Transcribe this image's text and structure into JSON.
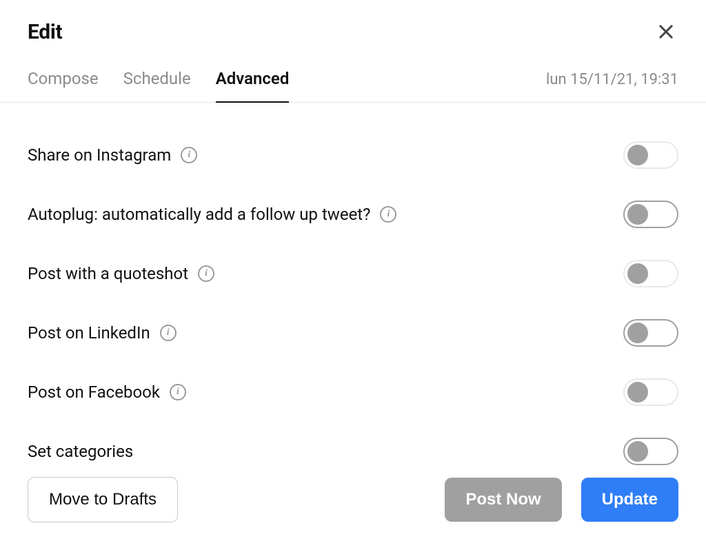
{
  "header": {
    "title": "Edit",
    "timestamp": "lun 15/11/21, 19:31"
  },
  "tabs": [
    {
      "label": "Compose",
      "active": false
    },
    {
      "label": "Schedule",
      "active": false
    },
    {
      "label": "Advanced",
      "active": true
    }
  ],
  "options": {
    "share_instagram": {
      "label": "Share on Instagram",
      "info": true,
      "on": false,
      "border": "light"
    },
    "autoplug": {
      "label": "Autoplug: automatically add a follow up tweet?",
      "info": true,
      "on": false,
      "border": "dark"
    },
    "quoteshot": {
      "label": "Post with a quoteshot",
      "info": true,
      "on": false,
      "border": "light"
    },
    "linkedin": {
      "label": "Post on LinkedIn",
      "info": true,
      "on": false,
      "border": "dark"
    },
    "facebook": {
      "label": "Post on Facebook",
      "info": true,
      "on": false,
      "border": "light"
    },
    "categories": {
      "label": "Set categories",
      "info": false,
      "on": false,
      "border": "dark"
    }
  },
  "footer": {
    "move_to_drafts": "Move to Drafts",
    "post_now": "Post Now",
    "update": "Update"
  },
  "colors": {
    "primary": "#2f7ef7",
    "muted": "#a0a0a0",
    "text": "#111111",
    "border": "#e6e6e6"
  }
}
